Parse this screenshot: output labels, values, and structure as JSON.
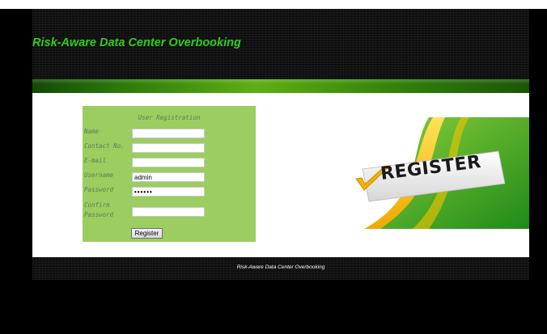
{
  "header": {
    "title": "Risk-Aware Data Center Overbooking"
  },
  "form": {
    "heading": "User Registration",
    "fields": [
      {
        "label": "Name",
        "value": ""
      },
      {
        "label": "Contact No.",
        "value": ""
      },
      {
        "label": "E-mail",
        "value": ""
      },
      {
        "label": "Username",
        "value": "admin"
      },
      {
        "label": "Password",
        "value": "••••••"
      },
      {
        "label_line1": "Confirm",
        "label_line2": "Password",
        "value": ""
      }
    ],
    "submit_label": "Register"
  },
  "banner": {
    "text": "REGISTER",
    "icon": "checkmark-icon"
  },
  "footer": {
    "text": "Risk-Aware Data Center Overbooking"
  },
  "colors": {
    "title": "#33cc1f",
    "panel": "#9bcd60",
    "label": "#5e7d52"
  }
}
